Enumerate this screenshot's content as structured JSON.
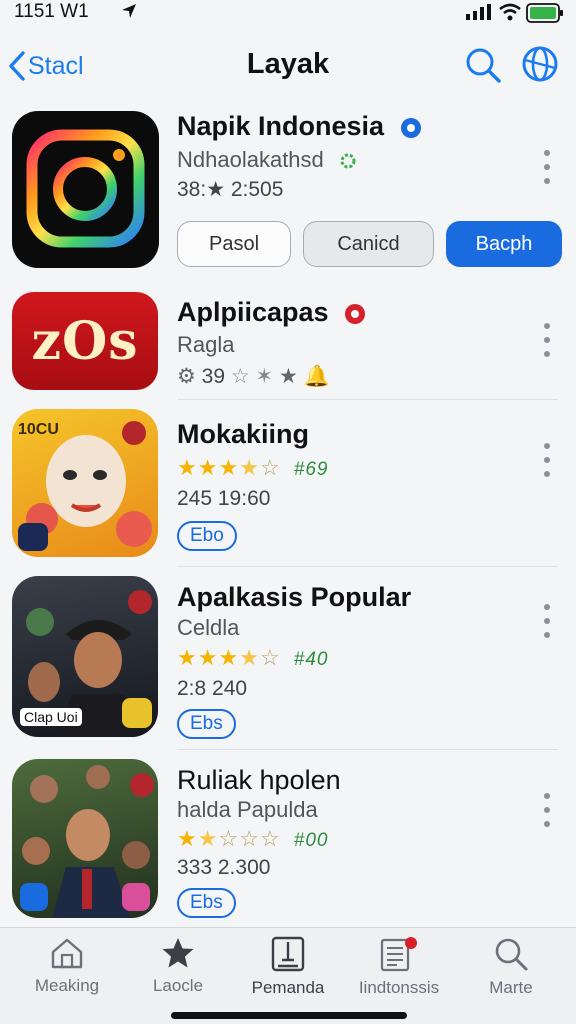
{
  "status_bar": {
    "time": "1151 W1"
  },
  "nav": {
    "back_label": "Stacl",
    "title": "Layak"
  },
  "apps": [
    {
      "name": "Napik Indonesia",
      "subtitle": "Ndhaolakathsd",
      "meta": "38:★ 2:505",
      "buttons": {
        "left": "Pasol",
        "middle": "Canicd",
        "right": "Bacph"
      }
    },
    {
      "name": "Aplpiicapas",
      "subtitle": "Ragla",
      "meta": "39",
      "icon_text": "zOs"
    },
    {
      "name": "Mokakiing",
      "rating_label": "#69",
      "rating": 3.5,
      "meta": "245 19:60",
      "tag": "Ebo",
      "icon_text": "10CU"
    },
    {
      "name": "Apalkasis Popular",
      "subtitle": "Celdla",
      "rating_label": "#40",
      "rating": 3.5,
      "meta": "2:8 240",
      "tag": "Ebs",
      "icon_text": "Clap Uoi"
    },
    {
      "name": "Ruliak hpolen",
      "subtitle": "halda Papulda",
      "rating_label": "#00",
      "rating": 1.5,
      "meta": "333 2.300",
      "tag": "Ebs"
    }
  ],
  "tabs": [
    {
      "label": "Meaking",
      "icon": "house-icon"
    },
    {
      "label": "Laocle",
      "icon": "star-icon"
    },
    {
      "label": "Pemanda",
      "icon": "book-icon"
    },
    {
      "label": "Iindtonssis",
      "icon": "list-icon"
    },
    {
      "label": "Marte",
      "icon": "search-icon"
    }
  ],
  "colors": {
    "accent": "#1a6ae0",
    "star": "#f5b400",
    "rating_label": "#2e8b3e"
  }
}
